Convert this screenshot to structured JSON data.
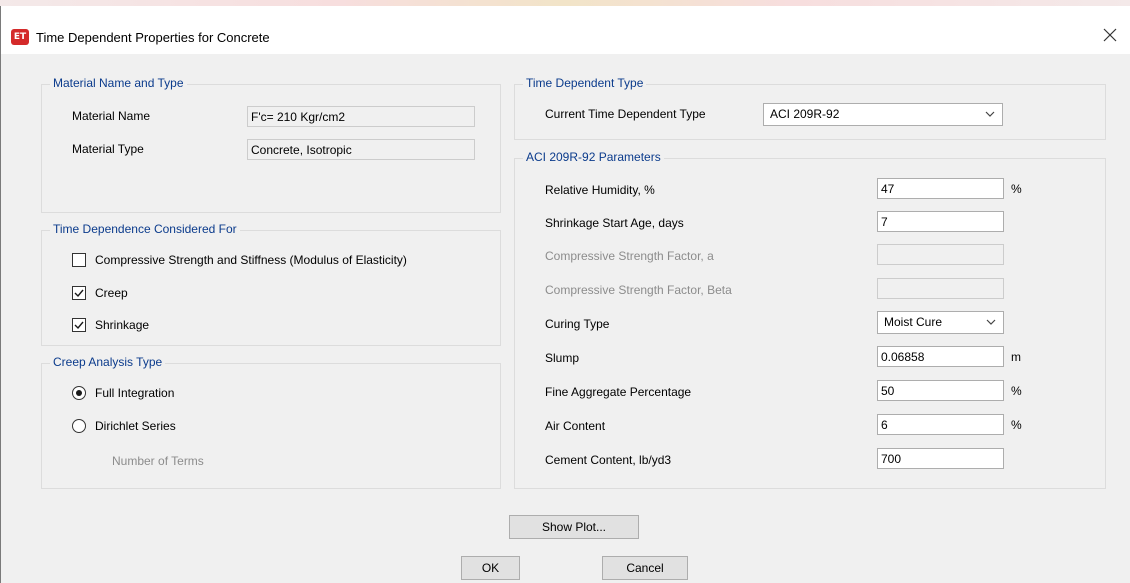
{
  "window": {
    "title": "Time Dependent Properties for Concrete",
    "icon_text": "ET",
    "icon_color": "#d42a2a"
  },
  "material": {
    "group_title": "Material Name and Type",
    "name_label": "Material Name",
    "name_value": "F'c= 210 Kgr/cm2",
    "type_label": "Material Type",
    "type_value": "Concrete, Isotropic"
  },
  "time_dependence": {
    "group_title": "Time Dependence Considered For",
    "options": [
      {
        "label": "Compressive Strength and Stiffness  (Modulus of Elasticity)",
        "checked": false
      },
      {
        "label": "Creep",
        "checked": true
      },
      {
        "label": "Shrinkage",
        "checked": true
      }
    ]
  },
  "creep_analysis": {
    "group_title": "Creep Analysis Type",
    "options": [
      {
        "label": "Full Integration",
        "selected": true
      },
      {
        "label": "Dirichlet Series",
        "selected": false
      }
    ],
    "terms_label": "Number of Terms"
  },
  "time_dependent_type": {
    "group_title": "Time Dependent Type",
    "label": "Current Time Dependent Type",
    "value": "ACI 209R-92"
  },
  "aci_params": {
    "group_title": "ACI 209R-92 Parameters",
    "humidity_label": "Relative Humidity, %",
    "humidity_value": "47",
    "humidity_unit": "%",
    "shrinkage_age_label": "Shrinkage Start Age, days",
    "shrinkage_age_value": "7",
    "strength_a_label": "Compressive Strength Factor, a",
    "strength_beta_label": "Compressive Strength Factor, Beta",
    "curing_label": "Curing Type",
    "curing_value": "Moist Cure",
    "slump_label": "Slump",
    "slump_value": "0.06858",
    "slump_unit": "m",
    "fine_agg_label": "Fine Aggregate Percentage",
    "fine_agg_value": "50",
    "fine_agg_unit": "%",
    "air_label": "Air Content",
    "air_value": "6",
    "air_unit": "%",
    "cement_label": "Cement Content, lb/yd3",
    "cement_value": "700"
  },
  "buttons": {
    "show_plot": "Show Plot...",
    "ok": "OK",
    "cancel": "Cancel"
  }
}
